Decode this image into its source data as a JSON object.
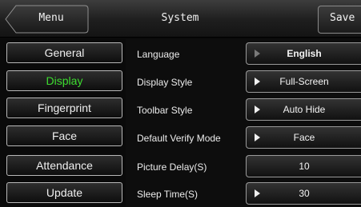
{
  "header": {
    "menu_label": "Menu",
    "title": "System",
    "save_label": "Save"
  },
  "sidebar": {
    "items": [
      {
        "label": "General",
        "active": false
      },
      {
        "label": "Display",
        "active": true
      },
      {
        "label": "Fingerprint",
        "active": false
      },
      {
        "label": "Face",
        "active": false
      },
      {
        "label": "Attendance",
        "active": false
      },
      {
        "label": "Update",
        "active": false
      }
    ]
  },
  "settings": {
    "rows": [
      {
        "label": "Language",
        "value": "English",
        "arrow": "play-arrow-icon-dim"
      },
      {
        "label": "Display Style",
        "value": "Full-Screen",
        "arrow": "play-arrow-icon"
      },
      {
        "label": "Toolbar Style",
        "value": "Auto Hide",
        "arrow": "play-arrow-icon"
      },
      {
        "label": "Default Verify Mode",
        "value": "Face",
        "arrow": "play-arrow-icon"
      },
      {
        "label": "Picture Delay(S)",
        "value": "10",
        "arrow": ""
      },
      {
        "label": "Sleep Time(S)",
        "value": "30",
        "arrow": "play-arrow-icon"
      }
    ]
  },
  "colors": {
    "active_text": "#3ddc2f",
    "background": "#0a0a0a"
  }
}
